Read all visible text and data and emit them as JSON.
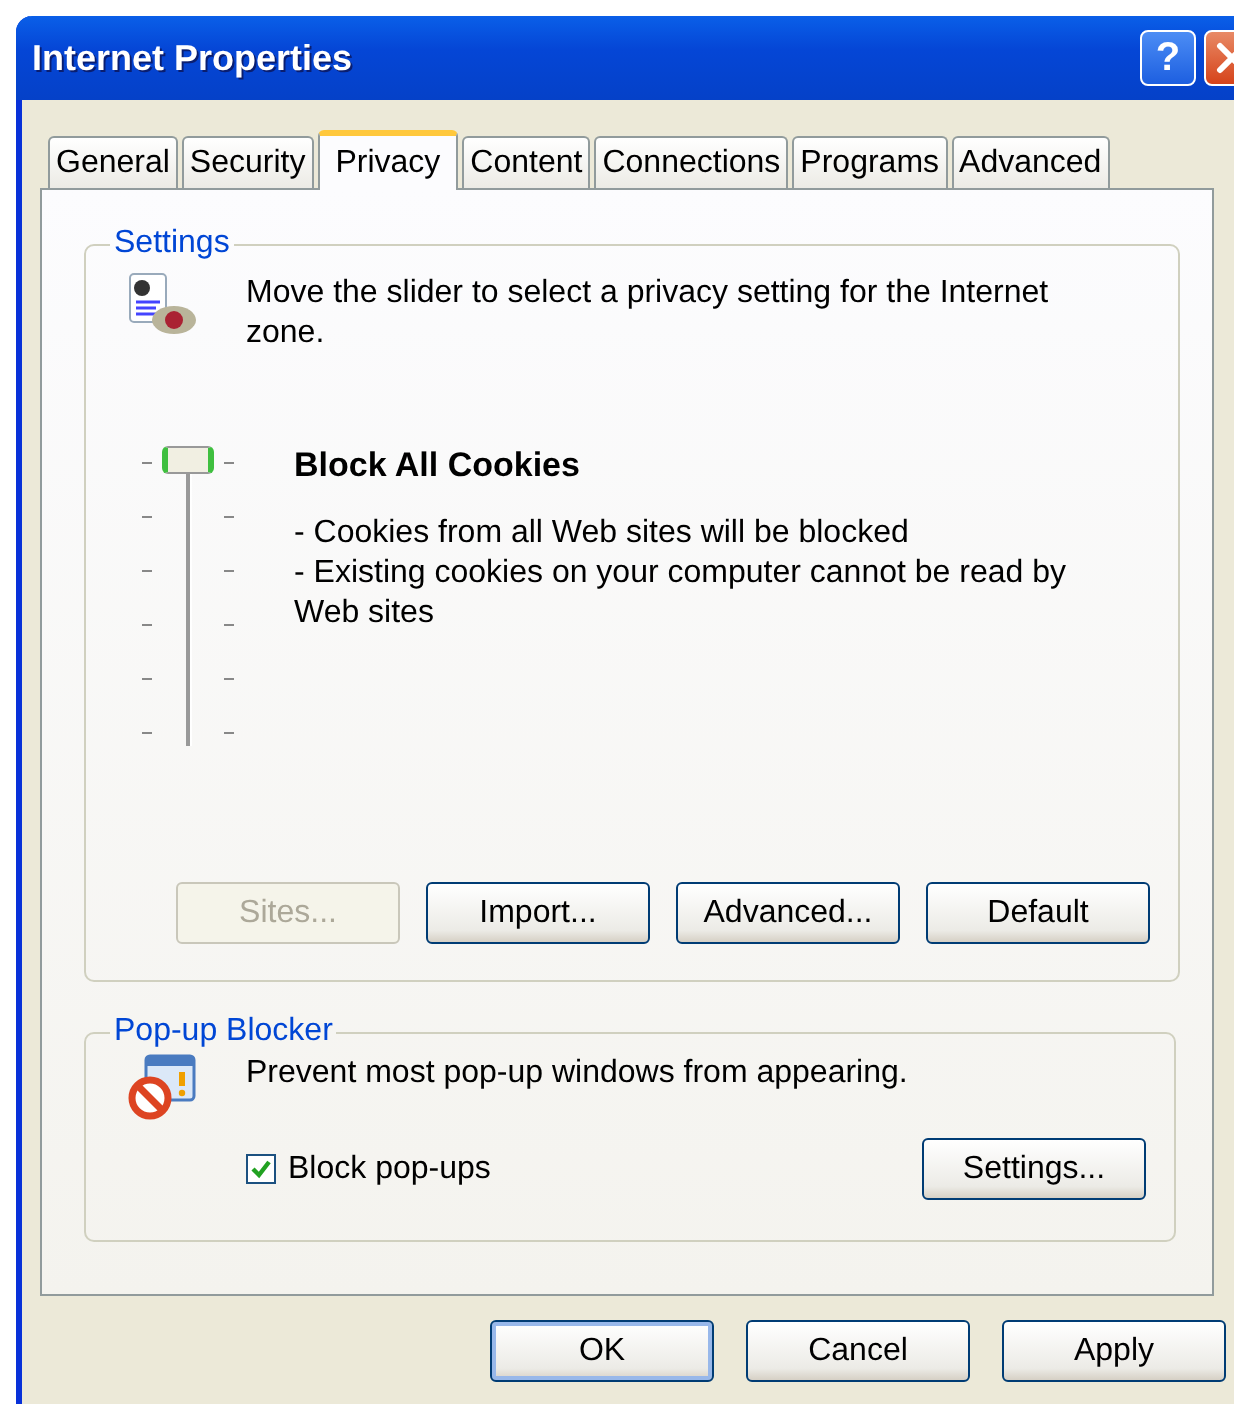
{
  "window": {
    "title": "Internet Properties",
    "help_button": "?"
  },
  "tabs": [
    {
      "label": "General",
      "selected": false
    },
    {
      "label": "Security",
      "selected": false
    },
    {
      "label": "Privacy",
      "selected": true
    },
    {
      "label": "Content",
      "selected": false
    },
    {
      "label": "Connections",
      "selected": false
    },
    {
      "label": "Programs",
      "selected": false
    },
    {
      "label": "Advanced",
      "selected": false
    }
  ],
  "settings": {
    "legend": "Settings",
    "description": "Move the slider to select a privacy setting for the Internet zone.",
    "slider": {
      "level": 1
    },
    "level_title": "Block All Cookies",
    "level_details": [
      "- Cookies from all Web sites will be blocked",
      "- Existing cookies on your computer cannot be read by Web sites"
    ],
    "buttons": [
      {
        "label": "Sites...",
        "disabled": true
      },
      {
        "label": "Import...",
        "disabled": false
      },
      {
        "label": "Advanced...",
        "disabled": false
      },
      {
        "label": "Default",
        "disabled": false
      }
    ]
  },
  "popup_blocker": {
    "legend": "Pop-up Blocker",
    "description": "Prevent most pop-up windows from appearing.",
    "checkbox": {
      "label": "Block pop-ups",
      "checked": true
    },
    "button": "Settings..."
  },
  "footer_buttons": [
    "OK",
    "Cancel",
    "Apply"
  ]
}
